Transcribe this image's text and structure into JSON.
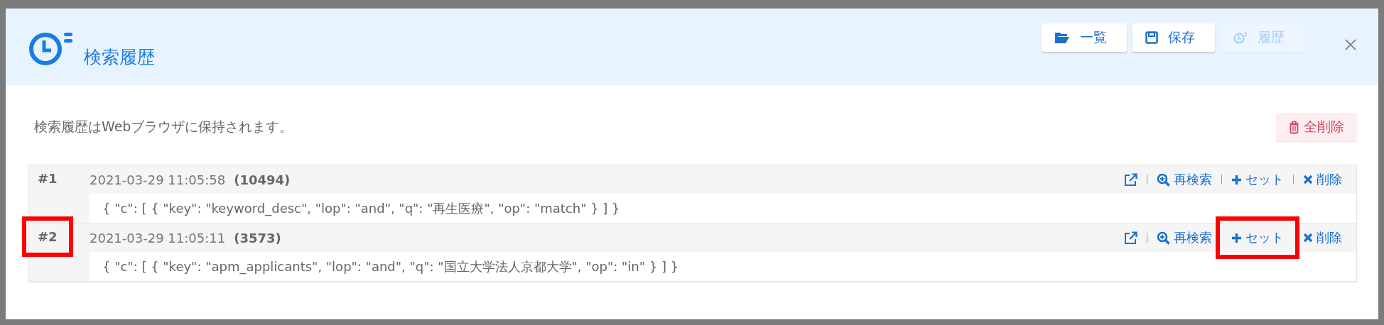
{
  "dialog": {
    "title": "検索履歴",
    "buttons": [
      {
        "label": "一覧",
        "kind": "list",
        "disabled": false
      },
      {
        "label": "保存",
        "kind": "save",
        "disabled": false
      },
      {
        "label": "履歴",
        "kind": "history",
        "disabled": true
      }
    ]
  },
  "notice": "検索履歴はWebブラウザに保持されます。",
  "clear_all_button": "全削除",
  "entries": [
    {
      "number": "#1",
      "highlighted": false,
      "timestamp": "2021-03-29 11:05:58",
      "count": "(10494)",
      "query": "{ \"c\": [ { \"key\": \"keyword_desc\", \"lop\": \"and\", \"q\": \"再生医療\", \"op\": \"match\" } ] }",
      "actions": [
        {
          "kind": "open",
          "highlighted": false
        },
        {
          "kind": "search",
          "label": "再検索",
          "highlighted": false
        },
        {
          "kind": "set",
          "label": "セット",
          "highlighted": false
        },
        {
          "kind": "delete",
          "label": "削除",
          "highlighted": false
        }
      ]
    },
    {
      "number": "#2",
      "highlighted": true,
      "timestamp": "2021-03-29 11:05:11",
      "count": "(3573)",
      "query": "{ \"c\": [ { \"key\": \"apm_applicants\", \"lop\": \"and\", \"q\": \"国立大学法人京都大学\", \"op\": \"in\" } ] }",
      "actions": [
        {
          "kind": "open",
          "highlighted": false
        },
        {
          "kind": "search",
          "label": "再検索",
          "highlighted": false
        },
        {
          "kind": "set",
          "label": "セット",
          "highlighted": true
        },
        {
          "kind": "delete",
          "label": "削除",
          "highlighted": false
        }
      ]
    }
  ]
}
